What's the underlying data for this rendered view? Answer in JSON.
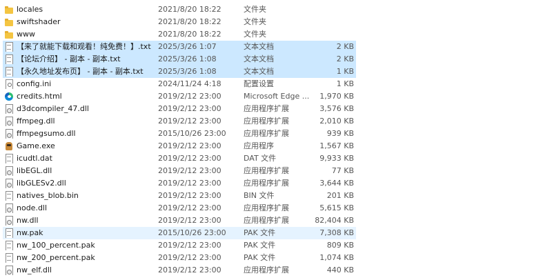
{
  "files": [
    {
      "name": "locales",
      "date": "2021/8/20 18:22",
      "type": "文件夹",
      "size": "",
      "icon": "folder-icon",
      "state": ""
    },
    {
      "name": "swiftshader",
      "date": "2021/8/20 18:22",
      "type": "文件夹",
      "size": "",
      "icon": "folder-icon",
      "state": ""
    },
    {
      "name": "www",
      "date": "2021/8/20 18:22",
      "type": "文件夹",
      "size": "",
      "icon": "folder-icon",
      "state": ""
    },
    {
      "name": "【来了就能下载和观看！纯免费！】.txt",
      "date": "2025/3/26 1:07",
      "type": "文本文档",
      "size": "2 KB",
      "icon": "text-file-icon",
      "state": "selected"
    },
    {
      "name": "【论坛介绍】 - 副本 - 副本.txt",
      "date": "2025/3/26 1:08",
      "type": "文本文档",
      "size": "2 KB",
      "icon": "text-file-icon",
      "state": "selected"
    },
    {
      "name": "【永久地址发布页】 - 副本 - 副本.txt",
      "date": "2025/3/26 1:08",
      "type": "文本文档",
      "size": "1 KB",
      "icon": "text-file-icon",
      "state": "selected"
    },
    {
      "name": "config.ini",
      "date": "2024/11/24 4:18",
      "type": "配置设置",
      "size": "1 KB",
      "icon": "config-file-icon",
      "state": ""
    },
    {
      "name": "credits.html",
      "date": "2019/2/12 23:00",
      "type": "Microsoft Edge ...",
      "size": "1,970 KB",
      "icon": "edge-icon",
      "state": ""
    },
    {
      "name": "d3dcompiler_47.dll",
      "date": "2019/2/12 23:00",
      "type": "应用程序扩展",
      "size": "3,576 KB",
      "icon": "dll-file-icon",
      "state": ""
    },
    {
      "name": "ffmpeg.dll",
      "date": "2019/2/12 23:00",
      "type": "应用程序扩展",
      "size": "2,010 KB",
      "icon": "dll-file-icon",
      "state": ""
    },
    {
      "name": "ffmpegsumo.dll",
      "date": "2015/10/26 23:00",
      "type": "应用程序扩展",
      "size": "939 KB",
      "icon": "dll-file-icon",
      "state": ""
    },
    {
      "name": "Game.exe",
      "date": "2019/2/12 23:00",
      "type": "应用程序",
      "size": "1,567 KB",
      "icon": "game-exe-icon",
      "state": ""
    },
    {
      "name": "icudtl.dat",
      "date": "2019/2/12 23:00",
      "type": "DAT 文件",
      "size": "9,933 KB",
      "icon": "file-icon",
      "state": ""
    },
    {
      "name": "libEGL.dll",
      "date": "2019/2/12 23:00",
      "type": "应用程序扩展",
      "size": "77 KB",
      "icon": "dll-file-icon",
      "state": ""
    },
    {
      "name": "libGLESv2.dll",
      "date": "2019/2/12 23:00",
      "type": "应用程序扩展",
      "size": "3,644 KB",
      "icon": "dll-file-icon",
      "state": ""
    },
    {
      "name": "natives_blob.bin",
      "date": "2019/2/12 23:00",
      "type": "BIN 文件",
      "size": "201 KB",
      "icon": "file-icon",
      "state": ""
    },
    {
      "name": "node.dll",
      "date": "2019/2/12 23:00",
      "type": "应用程序扩展",
      "size": "5,615 KB",
      "icon": "dll-file-icon",
      "state": ""
    },
    {
      "name": "nw.dll",
      "date": "2019/2/12 23:00",
      "type": "应用程序扩展",
      "size": "82,404 KB",
      "icon": "dll-file-icon",
      "state": ""
    },
    {
      "name": "nw.pak",
      "date": "2015/10/26 23:00",
      "type": "PAK 文件",
      "size": "7,308 KB",
      "icon": "file-icon",
      "state": "hover"
    },
    {
      "name": "nw_100_percent.pak",
      "date": "2019/2/12 23:00",
      "type": "PAK 文件",
      "size": "809 KB",
      "icon": "file-icon",
      "state": ""
    },
    {
      "name": "nw_200_percent.pak",
      "date": "2019/2/12 23:00",
      "type": "PAK 文件",
      "size": "1,074 KB",
      "icon": "file-icon",
      "state": ""
    },
    {
      "name": "nw_elf.dll",
      "date": "2019/2/12 23:00",
      "type": "应用程序扩展",
      "size": "440 KB",
      "icon": "dll-file-icon",
      "state": ""
    }
  ]
}
